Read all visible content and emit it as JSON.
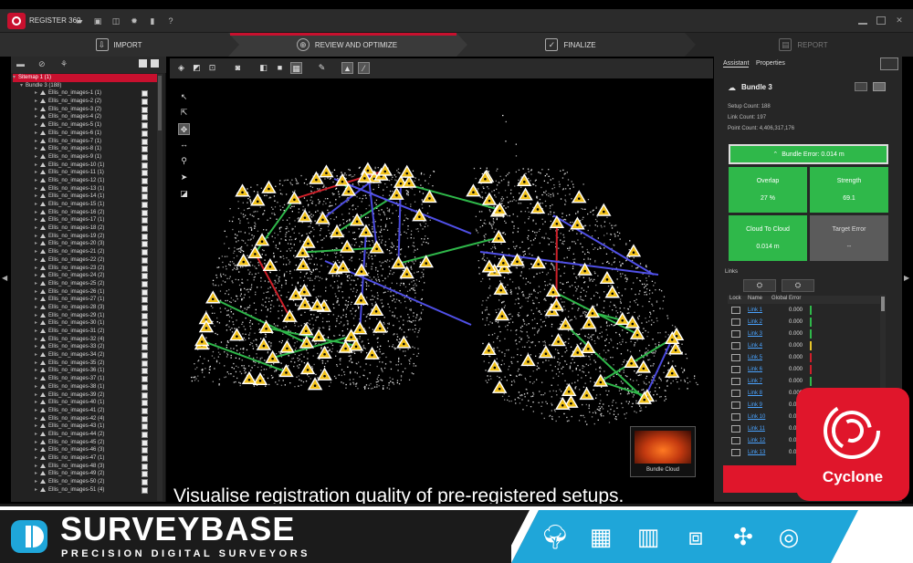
{
  "app": {
    "name": "REGISTER 360"
  },
  "workflow": {
    "steps": [
      {
        "label": "IMPORT",
        "icon": "import-icon"
      },
      {
        "label": "REVIEW AND OPTIMIZE",
        "icon": "review-icon"
      },
      {
        "label": "FINALIZE",
        "icon": "finalize-icon"
      },
      {
        "label": "REPORT",
        "icon": "report-icon"
      }
    ],
    "active": "REVIEW AND OPTIMIZE"
  },
  "tree": {
    "sitemap": "Sitemap 1 (1)",
    "bundle": "Bundle 3 (188)",
    "items": [
      "Ellis_no_images-1 (1)",
      "Ellis_no_images-2 (2)",
      "Ellis_no_images-3 (2)",
      "Ellis_no_images-4 (2)",
      "Ellis_no_images-5 (1)",
      "Ellis_no_images-6 (1)",
      "Ellis_no_images-7 (1)",
      "Ellis_no_images-8 (1)",
      "Ellis_no_images-9 (1)",
      "Ellis_no_images-10 (1)",
      "Ellis_no_images-11 (1)",
      "Ellis_no_images-12 (1)",
      "Ellis_no_images-13 (1)",
      "Ellis_no_images-14 (1)",
      "Ellis_no_images-15 (1)",
      "Ellis_no_images-16 (2)",
      "Ellis_no_images-17 (1)",
      "Ellis_no_images-18 (2)",
      "Ellis_no_images-19 (2)",
      "Ellis_no_images-20 (3)",
      "Ellis_no_images-21 (2)",
      "Ellis_no_images-22 (2)",
      "Ellis_no_images-23 (2)",
      "Ellis_no_images-24 (2)",
      "Ellis_no_images-25 (2)",
      "Ellis_no_images-26 (1)",
      "Ellis_no_images-27 (1)",
      "Ellis_no_images-28 (3)",
      "Ellis_no_images-29 (1)",
      "Ellis_no_images-30 (1)",
      "Ellis_no_images-31 (2)",
      "Ellis_no_images-32 (4)",
      "Ellis_no_images-33 (2)",
      "Ellis_no_images-34 (2)",
      "Ellis_no_images-35 (2)",
      "Ellis_no_images-36 (1)",
      "Ellis_no_images-37 (1)",
      "Ellis_no_images-38 (1)",
      "Ellis_no_images-39 (2)",
      "Ellis_no_images-40 (1)",
      "Ellis_no_images-41 (2)",
      "Ellis_no_images-42 (4)",
      "Ellis_no_images-43 (1)",
      "Ellis_no_images-44 (2)",
      "Ellis_no_images-45 (2)",
      "Ellis_no_images-46 (3)",
      "Ellis_no_images-47 (1)",
      "Ellis_no_images-48 (3)",
      "Ellis_no_images-49 (2)",
      "Ellis_no_images-50 (2)",
      "Ellis_no_images-51 (4)"
    ]
  },
  "viewport": {
    "thumbnail_label": "Bundle Cloud"
  },
  "right_panel": {
    "tabs": [
      "Assistant",
      "Properties"
    ],
    "bundle_title": "Bundle 3",
    "setup_count": "Setup Count:  188",
    "link_count": "Link Count:  197",
    "point_count": "Point Count:  4,406,317,176",
    "bundle_error": "Bundle Error: 0.014 m",
    "tiles": [
      {
        "title": "Overlap",
        "value": "27 %",
        "status": "green"
      },
      {
        "title": "Strength",
        "value": "69.1",
        "status": "green"
      },
      {
        "title": "Cloud To Cloud",
        "value": "0.014 m",
        "status": "green"
      },
      {
        "title": "Target Error",
        "value": "--",
        "status": "gray"
      }
    ],
    "links_header": "Links",
    "columns": [
      "Lock",
      "Name",
      "Global Error"
    ],
    "links": [
      {
        "name": "Link 1",
        "error": "0.000",
        "color": "#2fb84a"
      },
      {
        "name": "Link 2",
        "error": "0.000",
        "color": "#2fb84a"
      },
      {
        "name": "Link 3",
        "error": "0.000",
        "color": "#2fb84a"
      },
      {
        "name": "Link 4",
        "error": "0.000",
        "color": "#e6c42a"
      },
      {
        "name": "Link 5",
        "error": "0.000",
        "color": "#d0202a"
      },
      {
        "name": "Link 6",
        "error": "0.000",
        "color": "#d0202a"
      },
      {
        "name": "Link 7",
        "error": "0.000",
        "color": "#2fb84a"
      },
      {
        "name": "Link 8",
        "error": "0.000",
        "color": "#d0202a"
      },
      {
        "name": "Link 9",
        "error": "0.000",
        "color": "#d0202a"
      },
      {
        "name": "Link 10",
        "error": "0.000",
        "color": "#d0202a"
      },
      {
        "name": "Link 11",
        "error": "0.000",
        "color": "#d0202a"
      },
      {
        "name": "Link 12",
        "error": "0.000",
        "color": "#d0202a"
      },
      {
        "name": "Link 13",
        "error": "0.000",
        "color": "#d0202a"
      }
    ]
  },
  "overlay": {
    "caption": "Visualise registration quality of pre-registered setups.",
    "cyclone_label": "Cyclone"
  },
  "banner": {
    "company": "SURVEYBASE",
    "tagline": "PRECISION DIGITAL SURVEYORS",
    "service_icons": [
      "tree-icon",
      "building-icon",
      "facade-icon",
      "scanner-icon",
      "drone-icon",
      "target-icon"
    ]
  },
  "colors": {
    "brand_red": "#c8102e",
    "good_green": "#2fb84a",
    "banner_blue": "#1fa6d9"
  }
}
